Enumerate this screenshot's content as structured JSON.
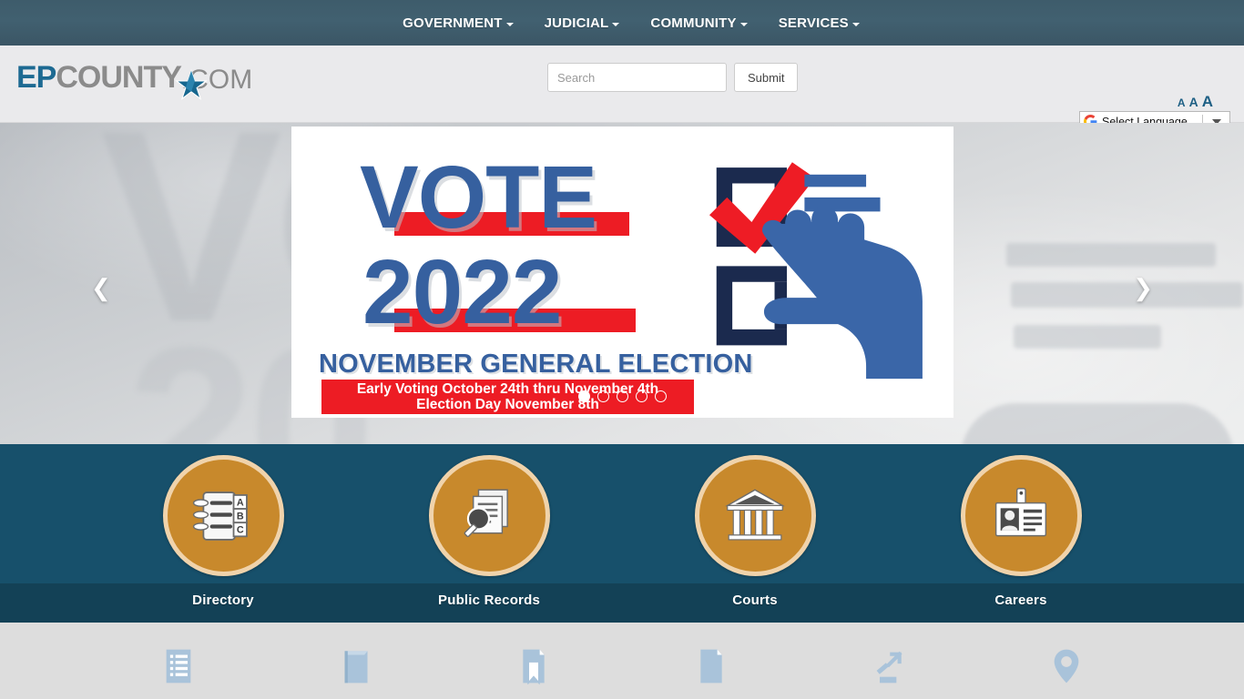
{
  "topnav": {
    "items": [
      {
        "label": "GOVERNMENT",
        "icon": "chevron-down-icon"
      },
      {
        "label": "JUDICIAL",
        "icon": "chevron-down-icon"
      },
      {
        "label": "COMMUNITY",
        "icon": "chevron-down-icon"
      },
      {
        "label": "SERVICES",
        "icon": "chevron-down-icon"
      }
    ],
    "background": "#416070"
  },
  "header": {
    "logo": {
      "part1": "EP",
      "part2": "COUNTY",
      "part3": ".COM",
      "icon": "star-icon",
      "color1": "#1d6a92",
      "color2": "#8b8b8b"
    },
    "search": {
      "placeholder": "Search",
      "value": "",
      "submit_label": "Submit"
    },
    "text_size": {
      "small": "A",
      "medium": "A",
      "large": "A",
      "color": "#1d5f84"
    },
    "translate": {
      "icon": "google-g-icon",
      "label": "Select Language",
      "caret": "chevron-down-icon"
    }
  },
  "carousel": {
    "prev_icon": "chevron-left-icon",
    "next_icon": "chevron-right-icon",
    "slide": {
      "headline1": "VOTE",
      "headline2": "2022",
      "subhead": "NOVEMBER GENERAL ELECTION",
      "note_line1": "Early Voting October 24th thru November 4th",
      "note_line2": "Election Day November 8th",
      "blue": "#36609f",
      "red": "#ed1c24",
      "art_icon": "ballot-checkbox-hand-icon"
    },
    "indicators": {
      "count": 5,
      "active_index": 0
    }
  },
  "quicklinks": {
    "background": "#17506b",
    "circle_color": "#c8892c",
    "ring_color": "#f0d3ab",
    "items": [
      {
        "label": "Directory",
        "icon": "address-book-icon"
      },
      {
        "label": "Public Records",
        "icon": "document-search-icon"
      },
      {
        "label": "Courts",
        "icon": "courthouse-icon"
      },
      {
        "label": "Careers",
        "icon": "id-badge-icon"
      }
    ]
  },
  "bottom_strip": {
    "background": "#dddddd",
    "icon_color": "#a9c3da",
    "items": [
      {
        "icon": "list-lines-icon"
      },
      {
        "icon": "book-icon"
      },
      {
        "icon": "bookmark-document-icon"
      },
      {
        "icon": "document-icon"
      },
      {
        "icon": "chart-arrow-icon"
      },
      {
        "icon": "location-pin-icon"
      }
    ]
  }
}
